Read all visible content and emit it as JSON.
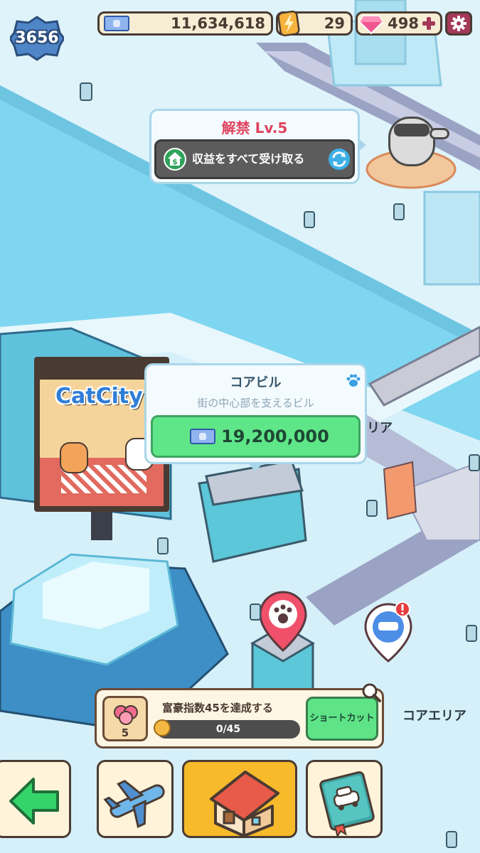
{
  "hud": {
    "player_level": "3656",
    "money": "11,634,618",
    "energy": "29",
    "gems": "498"
  },
  "unlock_popup": {
    "title": "解禁 Lv.5",
    "button_label": "収益をすべて受け取る"
  },
  "building_card": {
    "name": "コアビル",
    "description": "街の中心部を支えるビル",
    "price": "19,200,000"
  },
  "billboard": {
    "logo_text": "CatCity"
  },
  "map_labels": {
    "area_partial": "リア",
    "area_right": "コアエリア"
  },
  "mission": {
    "title": "富豪指数45を達成する",
    "reward_count": "5",
    "progress_text": "0/45",
    "progress_fraction": 0.0,
    "shortcut_label": "ショートカット"
  },
  "nav": {
    "items": [
      "back",
      "airport",
      "buildings",
      "vehicles"
    ],
    "active": "buildings"
  },
  "colors": {
    "accent_red": "#e0445e",
    "green_button": "#5fe688",
    "gold_button": "#f7ba2b",
    "water": "#7fd6f0"
  }
}
